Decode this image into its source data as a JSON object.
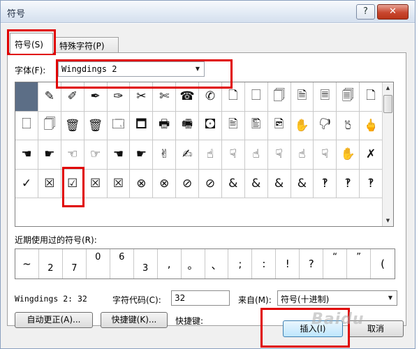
{
  "window": {
    "title": "符号",
    "help_label": "?",
    "close_label": "✕"
  },
  "tabs": [
    {
      "label": "符号(S)",
      "active": true
    },
    {
      "label": "特殊字符(P)",
      "active": false
    }
  ],
  "font": {
    "label": "字体(F):",
    "value": "Wingdings 2"
  },
  "symbols": {
    "rows": [
      [
        "",
        "✎",
        "✐",
        "✒",
        "✑",
        "✂",
        "✄",
        "☎",
        "✆",
        "🗋",
        "🗌",
        "🗍",
        "🗎",
        "🗏",
        "🗐",
        "🗋"
      ],
      [
        "🗌",
        "🗍",
        "🗑",
        "🗑",
        "🗔",
        "🗖",
        "🖶",
        "🖷",
        "🖸",
        "🖹",
        "🖺",
        "🖻",
        "✋",
        "🖓",
        "🖔",
        "🖕"
      ],
      [
        "☚",
        "☛",
        "☜",
        "☞",
        "☚",
        "☛",
        "✌",
        "✍",
        "☝",
        "☟",
        "☝",
        "☟",
        "☝",
        "☟",
        "✋",
        "✗"
      ],
      [
        "✓",
        "☒",
        "☑",
        "☒",
        "☒",
        "⊗",
        "⊗",
        "⊘",
        "⊘",
        "&",
        "&",
        "&",
        "&",
        "‽",
        "‽",
        "‽"
      ]
    ],
    "selected_index": 0
  },
  "recent": {
    "label": "近期使用过的符号(R):",
    "items": [
      "~",
      "2",
      "7",
      "0",
      "6",
      "3",
      ",",
      "。",
      "、",
      ";",
      ":",
      "!",
      "?",
      "“",
      "”",
      "("
    ]
  },
  "info": {
    "char_name": "Wingdings 2: 32",
    "code_label": "字符代码(C):",
    "code_value": "32",
    "from_label": "来自(M):",
    "from_value": "符号(十进制)"
  },
  "buttons": {
    "autocorrect": "自动更正(A)...",
    "shortcut_key": "快捷键(K)...",
    "shortcut_label": "快捷键:",
    "insert": "插入(I)",
    "cancel": "取消"
  },
  "watermark": "Baidu"
}
